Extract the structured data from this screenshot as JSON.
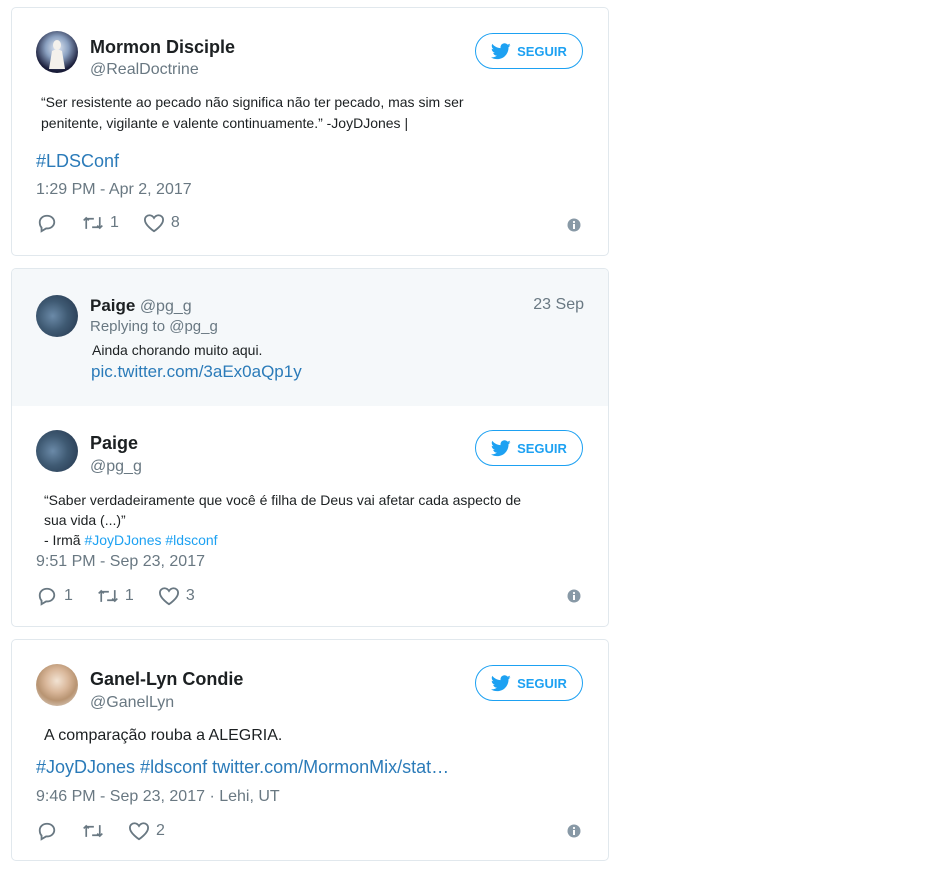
{
  "colors": {
    "accent": "#1da1f2",
    "link": "#2b7bb9",
    "muted": "#697882",
    "border": "#e1e8ed",
    "reply_bg": "#f5f8fa"
  },
  "tweet1": {
    "name": "Mormon Disciple",
    "handle": "@RealDoctrine",
    "follow_label": "SEGUIR",
    "text_line1": "“Ser resistente ao pecado não significa não ter pecado, mas sim ser",
    "text_line2": "penitente, vigilante e valente continuamente.” -JoyDJones |",
    "hashtag": "#LDSConf",
    "time": "1:29 PM - Apr 2, 2017",
    "retweets": "1",
    "likes": "8"
  },
  "tweet2": {
    "parent": {
      "name": "Paige",
      "handle": "@pg_g",
      "date": "23 Sep",
      "replying": "Replying to @pg_g",
      "text": "Ainda chorando muito aqui.",
      "link": "pic.twitter.com/3aEx0aQp1y"
    },
    "name": "Paige",
    "handle": "@pg_g",
    "follow_label": "SEGUIR",
    "text_line1": "“Saber verdadeiramente que você é filha de Deus vai afetar cada aspecto de",
    "text_line2": "sua vida (...)”",
    "text_line3_prefix": "- Irmã ",
    "hashtag1": "#JoyDJones",
    "hashtag2": "#ldsconf",
    "time": "9:51 PM - Sep 23, 2017",
    "replies": "1",
    "retweets": "1",
    "likes": "3"
  },
  "tweet3": {
    "name": "Ganel-Lyn Condie",
    "handle": "@GanelLyn",
    "follow_label": "SEGUIR",
    "text": "A comparação rouba a ALEGRIA.",
    "links": "#JoyDJones #ldsconf twitter.com/MormonMix/stat…",
    "time": "9:46 PM - Sep 23, 2017 · Lehi, UT",
    "likes": "2"
  },
  "icons": [
    "twitter-bird-icon",
    "reply-icon",
    "retweet-icon",
    "heart-icon",
    "info-icon"
  ]
}
